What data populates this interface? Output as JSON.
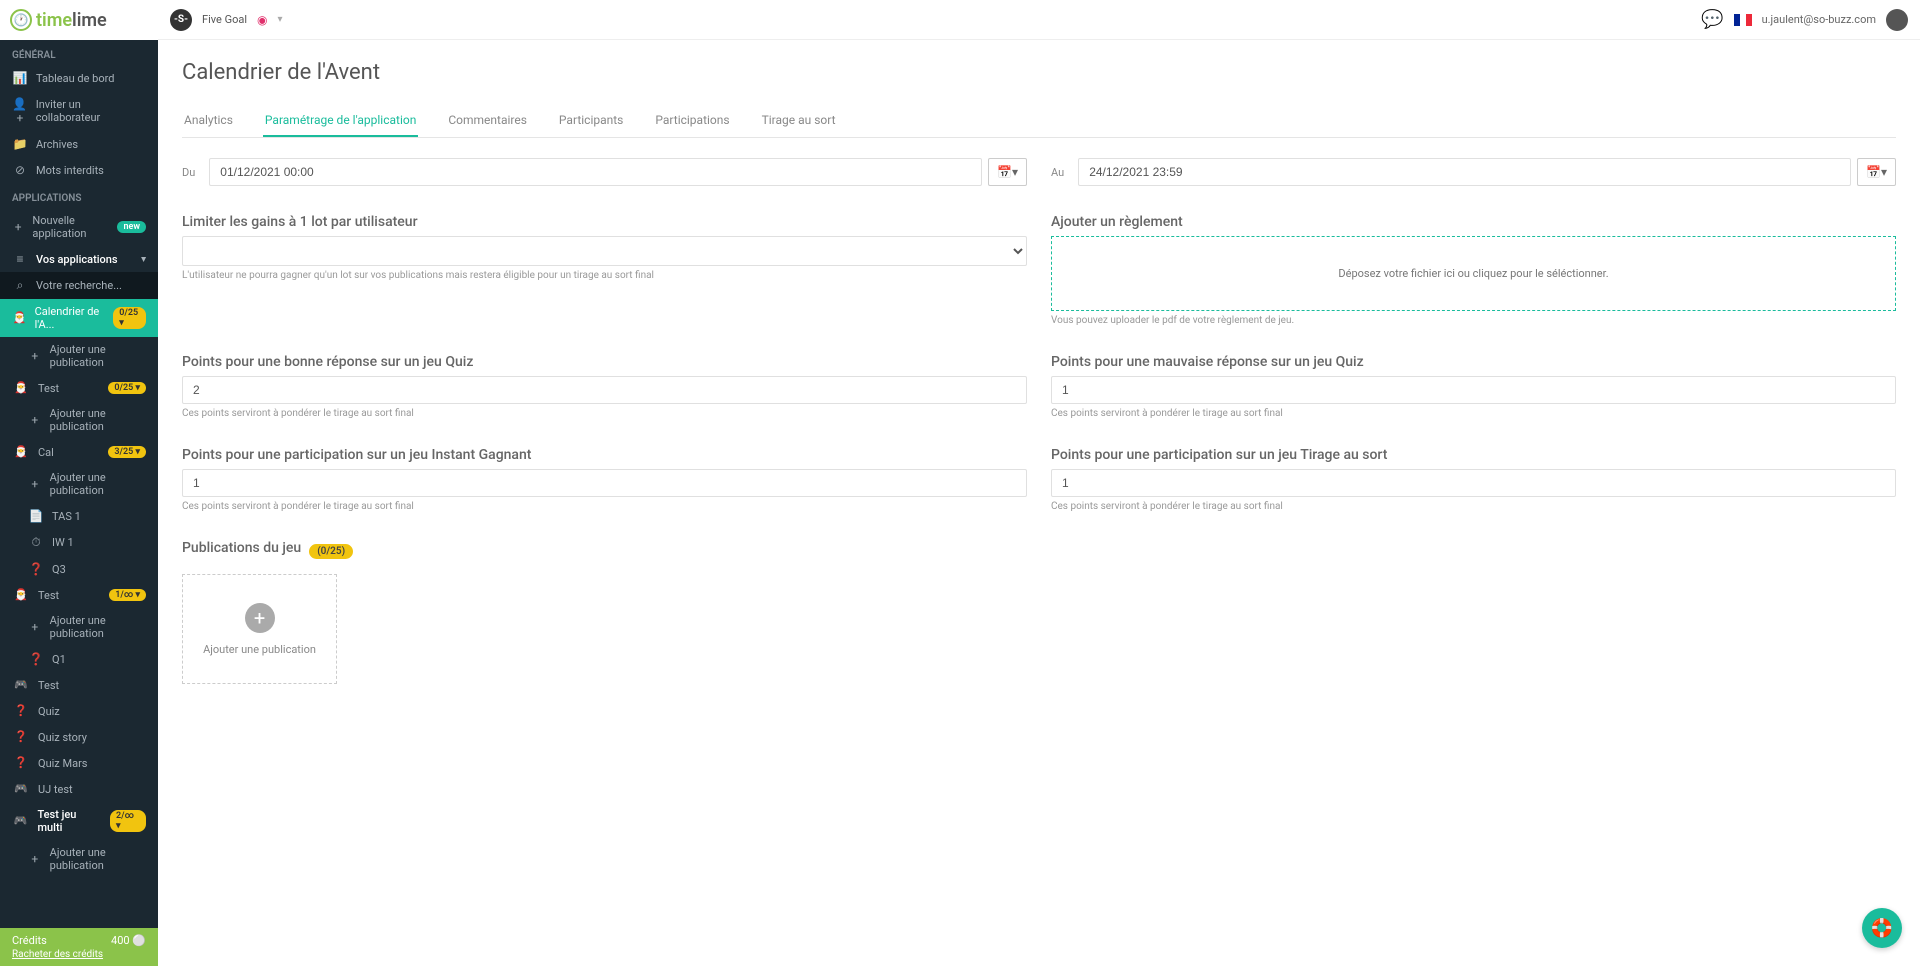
{
  "brand": {
    "name_g": "time",
    "name_d": "lime"
  },
  "header": {
    "account_name": "Five Goal",
    "account_initial": "-S-",
    "user_email": "u.jaulent@so-buzz.com"
  },
  "sidebar": {
    "general_title": "GÉNÉRAL",
    "general": [
      {
        "icon": "📊",
        "label": "Tableau de bord"
      },
      {
        "icon": "👤+",
        "label": "Inviter un collaborateur"
      },
      {
        "icon": "📁",
        "label": "Archives"
      },
      {
        "icon": "⊘",
        "label": "Mots interdits"
      }
    ],
    "apps_title": "APPLICATIONS",
    "new_app_label": "Nouvelle application",
    "new_badge": "new",
    "your_apps_label": "Vos applications",
    "search_placeholder": "Votre recherche...",
    "apps": [
      {
        "icon": "🎅",
        "label": "Calendrier de l'A...",
        "badge": "0/25 ▾",
        "active": true,
        "children": [
          {
            "icon": "+",
            "label": "Ajouter une publication"
          }
        ]
      },
      {
        "icon": "🎅",
        "label": "Test",
        "badge": "0/25 ▾",
        "children": [
          {
            "icon": "+",
            "label": "Ajouter une publication"
          }
        ]
      },
      {
        "icon": "🎅",
        "label": "Cal",
        "badge": "3/25 ▾",
        "children": [
          {
            "icon": "+",
            "label": "Ajouter une publication"
          },
          {
            "icon": "📄",
            "label": "TAS 1"
          },
          {
            "icon": "⏱",
            "label": "IW 1"
          },
          {
            "icon": "❓",
            "label": "Q3"
          }
        ]
      },
      {
        "icon": "🎅",
        "label": "Test",
        "badge": "1/∞ ▾",
        "children": [
          {
            "icon": "+",
            "label": "Ajouter une publication"
          },
          {
            "icon": "❓",
            "label": "Q1"
          }
        ]
      },
      {
        "icon": "🎮",
        "label": "Test"
      },
      {
        "icon": "❓",
        "label": "Quiz"
      },
      {
        "icon": "❓",
        "label": "Quiz story"
      },
      {
        "icon": "❓",
        "label": "Quiz Mars"
      },
      {
        "icon": "🎮",
        "label": "UJ test"
      },
      {
        "icon": "🎮",
        "label": "Test jeu multi",
        "badge": "2/∞ ▾",
        "bold": true,
        "children": [
          {
            "icon": "+",
            "label": "Ajouter une publication"
          }
        ]
      }
    ],
    "credits_label": "Crédits",
    "credits_value": "400 ⚪",
    "buy_credits": "Racheter des crédits"
  },
  "page": {
    "title": "Calendrier de l'Avent",
    "tabs": [
      "Analytics",
      "Paramétrage de l'application",
      "Commentaires",
      "Participants",
      "Participations",
      "Tirage au sort"
    ],
    "active_tab": 1,
    "date_from_label": "Du",
    "date_from": "01/12/2021 00:00",
    "date_to_label": "Au",
    "date_to": "24/12/2021 23:59",
    "limit_title": "Limiter les gains à 1 lot par utilisateur",
    "limit_help": "L'utilisateur ne pourra gagner qu'un lot sur vos publications mais restera éligible pour un tirage au sort final",
    "rules_title": "Ajouter un règlement",
    "rules_drop": "Déposez votre fichier ici ou cliquez pour le séléctionner.",
    "rules_help": "Vous pouvez uploader le pdf de votre règlement de jeu.",
    "points_quiz_good_title": "Points pour une bonne réponse sur un jeu Quiz",
    "points_quiz_good_value": "2",
    "points_quiz_bad_title": "Points pour une mauvaise réponse sur un jeu Quiz",
    "points_quiz_bad_value": "1",
    "points_instant_title": "Points pour une participation sur un jeu Instant Gagnant",
    "points_instant_value": "1",
    "points_tirage_title": "Points pour une participation sur un jeu Tirage au sort",
    "points_tirage_value": "1",
    "points_help": "Ces points serviront à pondérer le tirage au sort final",
    "pubs_title": "Publications du jeu",
    "pubs_badge": "(0/25)",
    "pubs_add": "Ajouter une publication"
  }
}
